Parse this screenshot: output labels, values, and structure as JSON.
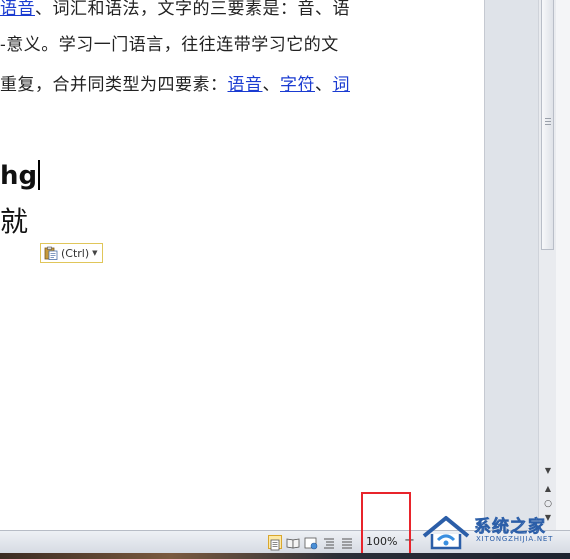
{
  "document": {
    "line1": {
      "link": "语音",
      "rest": "、词汇和语法，文字的三要素是：音、语"
    },
    "line2": "-意义。学习一门语言，往往连带学习它的文",
    "line3": {
      "text": "重复，合并同类型为四要素：",
      "link1": "语音",
      "sep1": "、",
      "link2": "字符",
      "sep2": "、",
      "link3": "词"
    },
    "typed_line": "hg",
    "chinese_line": "就"
  },
  "paste_options": {
    "label": "(Ctrl)"
  },
  "statusbar": {
    "zoom_level": "100%",
    "zoom_out_symbol": "−"
  },
  "watermark": {
    "title": "系统之家",
    "url": "XITONGZHIJIA.NET"
  },
  "colors": {
    "link": "#1a3bd1",
    "highlight": "#e8242b",
    "active_view": "#fde9a6"
  }
}
